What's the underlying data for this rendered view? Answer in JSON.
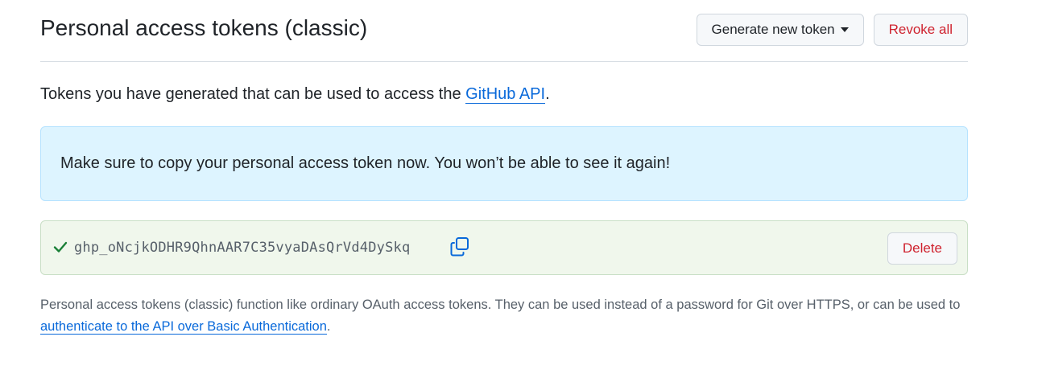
{
  "header": {
    "title": "Personal access tokens (classic)",
    "generate_label": "Generate new token",
    "revoke_label": "Revoke all"
  },
  "intro": {
    "text_before": "Tokens you have generated that can be used to access the ",
    "link_label": "GitHub API",
    "text_after": "."
  },
  "flash": {
    "message": "Make sure to copy your personal access token now. You won’t be able to see it again!"
  },
  "token": {
    "value": "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",
    "delete_label": "Delete"
  },
  "note": {
    "text_before": "Personal access tokens (classic) function like ordinary OAuth access tokens. They can be used instead of a password for Git over HTTPS, or can be used to ",
    "link_label": "authenticate to the API over Basic Authentication",
    "text_after": "."
  },
  "colors": {
    "accent_link": "#0969da",
    "danger": "#cf222e",
    "success": "#1a7f37",
    "flash_bg": "#ddf4ff",
    "token_bg": "#f0f7ec"
  },
  "icons": {
    "check": "check-icon",
    "copy": "copy-icon",
    "caret": "caret-down-icon"
  }
}
